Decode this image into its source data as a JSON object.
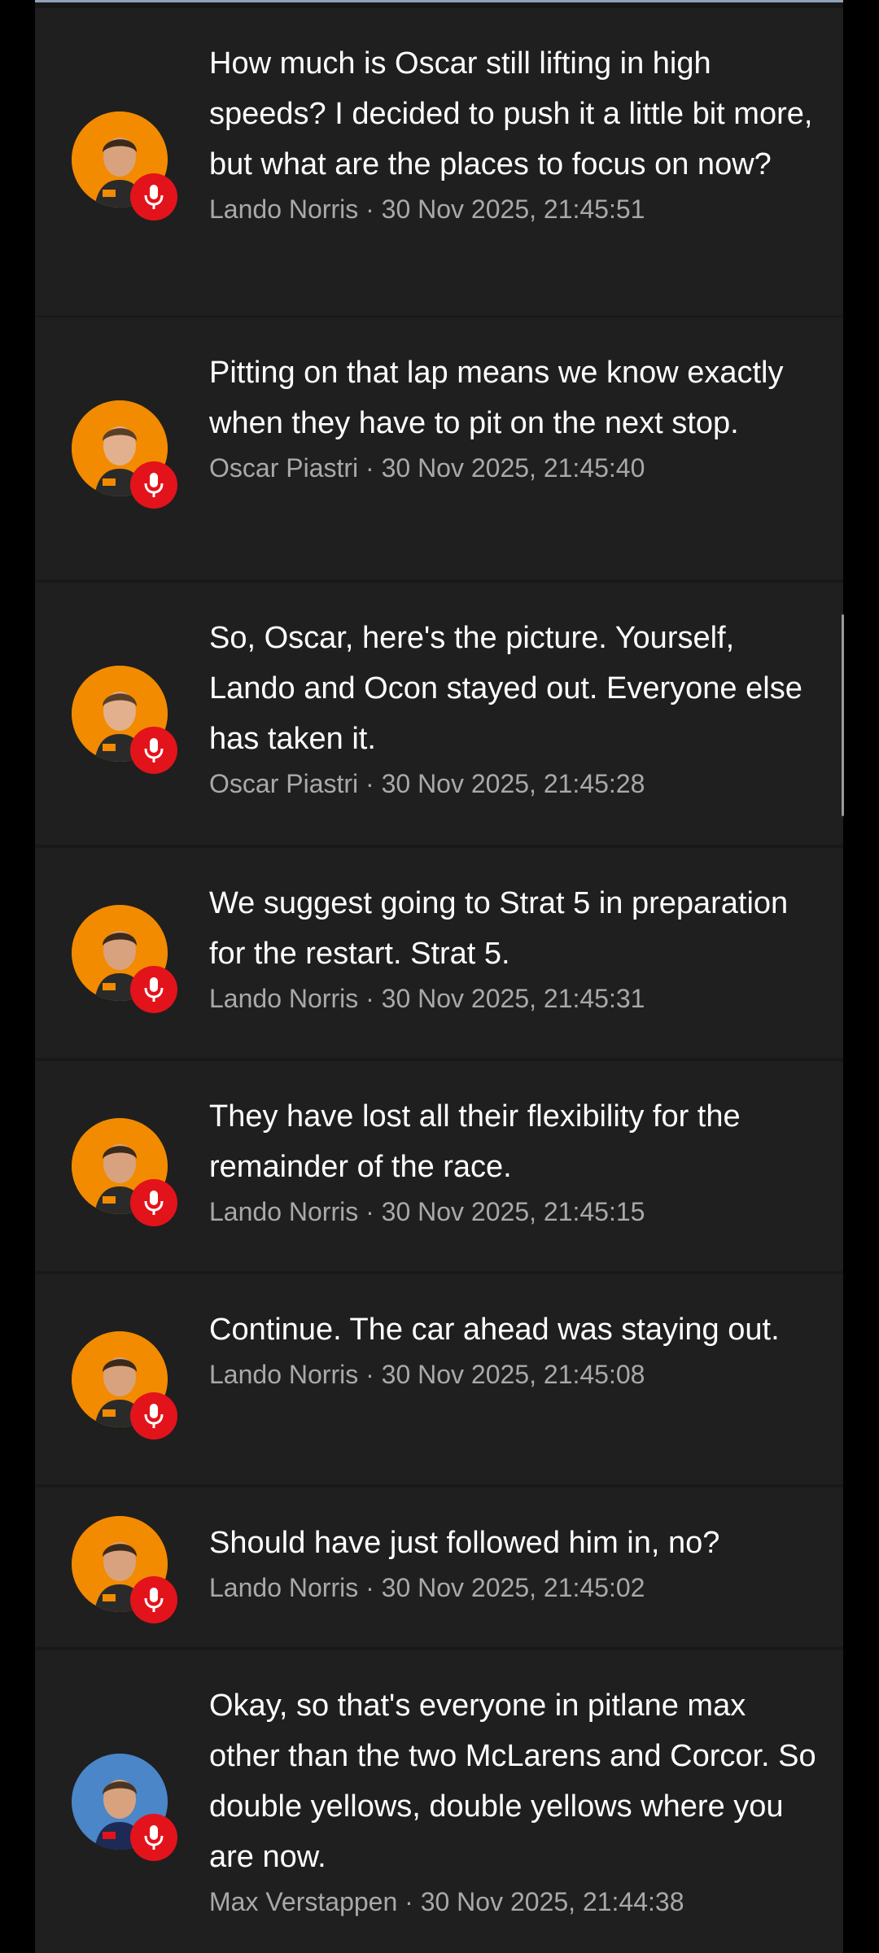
{
  "colors": {
    "background": "#000000",
    "row_background": "#1f1f1f",
    "text": "#ffffff",
    "meta_text": "#a9a9a9",
    "mic_badge": "#e3131b",
    "avatar_orange": "#f28b00",
    "avatar_blue": "#4a86c8"
  },
  "messages": [
    {
      "text": "How much is Oscar still lifting in high speeds? I decided to push it a little bit more, but what are the places to focus on now?",
      "meta": "Lando Norris · 30 Nov 2025, 21:45:51",
      "avatar_icon": "driver-portrait-icon",
      "badge_icon": "microphone-icon"
    },
    {
      "text": "Pitting on that lap means we know exactly when they have to pit on the next stop.",
      "meta": "Oscar Piastri · 30 Nov 2025, 21:45:40",
      "avatar_icon": "driver-portrait-icon",
      "badge_icon": "microphone-icon"
    },
    {
      "text": "So, Oscar, here's the picture. Yourself, Lando and Ocon stayed out. Everyone else has taken it.",
      "meta": "Oscar Piastri · 30 Nov 2025, 21:45:28",
      "avatar_icon": "driver-portrait-icon",
      "badge_icon": "microphone-icon"
    },
    {
      "text": "We suggest going to Strat 5 in preparation for the restart. Strat 5.",
      "meta": "Lando Norris · 30 Nov 2025, 21:45:31",
      "avatar_icon": "driver-portrait-icon",
      "badge_icon": "microphone-icon"
    },
    {
      "text": "They have lost all their flexibility for the remainder of the race.",
      "meta": "Lando Norris · 30 Nov 2025, 21:45:15",
      "avatar_icon": "driver-portrait-icon",
      "badge_icon": "microphone-icon"
    },
    {
      "text": "Continue. The car ahead was staying out.",
      "meta": "Lando Norris · 30 Nov 2025, 21:45:08",
      "avatar_icon": "driver-portrait-icon",
      "badge_icon": "microphone-icon"
    },
    {
      "text": "Should have just followed him in, no?",
      "meta": "Lando Norris · 30 Nov 2025, 21:45:02",
      "avatar_icon": "driver-portrait-icon",
      "badge_icon": "microphone-icon"
    },
    {
      "text": "Okay, so that's everyone in pitlane max other than the two McLarens and Corcor. So double yellows, double yellows where you are now.",
      "meta": "Max Verstappen · 30 Nov 2025, 21:44:38",
      "avatar_icon": "driver-portrait-icon",
      "badge_icon": "microphone-icon"
    }
  ]
}
